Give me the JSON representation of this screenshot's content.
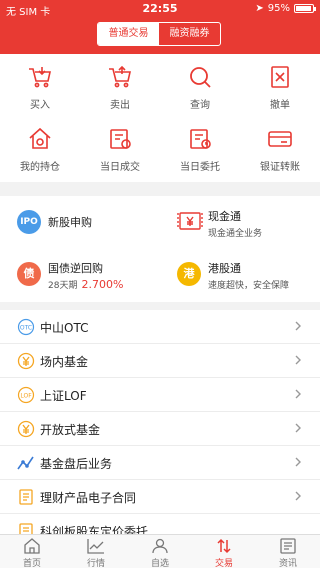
{
  "status_bar": {
    "carrier": "无 SIM 卡",
    "time": "22:55",
    "battery": "95%"
  },
  "header": {
    "segments": [
      "普通交易",
      "融资融券"
    ],
    "active_segment": 0
  },
  "grid": {
    "items": [
      {
        "label": "买入",
        "icon": "cart-in-icon"
      },
      {
        "label": "卖出",
        "icon": "cart-out-icon"
      },
      {
        "label": "查询",
        "icon": "search-icon"
      },
      {
        "label": "撤单",
        "icon": "cancel-order-icon"
      },
      {
        "label": "我的持仓",
        "icon": "holdings-icon"
      },
      {
        "label": "当日成交",
        "icon": "today-deals-icon"
      },
      {
        "label": "当日委托",
        "icon": "today-orders-icon"
      },
      {
        "label": "银证转账",
        "icon": "bank-transfer-icon"
      }
    ]
  },
  "features": {
    "new_stock": {
      "badge": "IPO",
      "title": "新股申购",
      "color": "#4a9be8"
    },
    "cash": {
      "title": "现金通",
      "subtitle": "现金通全业务",
      "color": "#e83a33"
    },
    "repo": {
      "badge": "债",
      "title": "国债逆回购",
      "term": "28天期",
      "rate": "2.700%",
      "color": "#f06a4a"
    },
    "hk": {
      "badge": "港",
      "title": "港股通",
      "subtitle": "速度超快，安全保障",
      "color": "#f5b800"
    }
  },
  "list": {
    "items": [
      {
        "label": "中山OTC",
        "icon": "otc-icon"
      },
      {
        "label": "场内基金",
        "icon": "exchange-fund-icon"
      },
      {
        "label": "上证LOF",
        "icon": "lof-icon"
      },
      {
        "label": "开放式基金",
        "icon": "open-fund-icon"
      },
      {
        "label": "基金盘后业务",
        "icon": "fund-after-hours-icon"
      },
      {
        "label": "理财产品电子合同",
        "icon": "contract-icon"
      },
      {
        "label": "科创板股东定价委托",
        "icon": "star-market-icon"
      }
    ]
  },
  "tabbar": {
    "active": 3,
    "tabs": [
      {
        "label": "首页",
        "icon": "home-icon"
      },
      {
        "label": "行情",
        "icon": "market-icon"
      },
      {
        "label": "自选",
        "icon": "watchlist-icon"
      },
      {
        "label": "交易",
        "icon": "trade-icon"
      },
      {
        "label": "资讯",
        "icon": "news-icon"
      }
    ]
  },
  "colors": {
    "accent": "#e83a33",
    "background": "#f2f2f2"
  }
}
